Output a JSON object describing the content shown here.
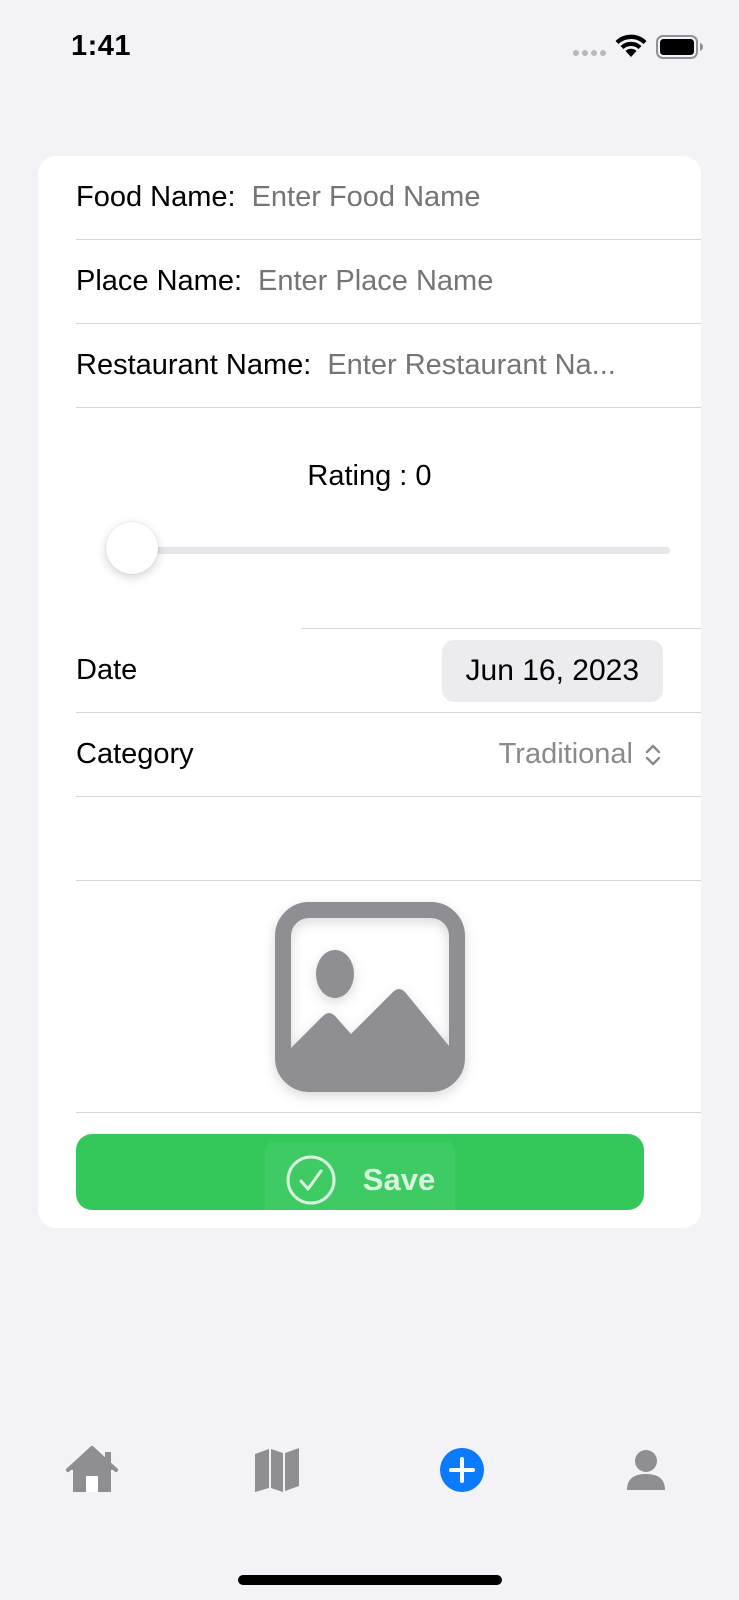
{
  "status_bar": {
    "time": "1:41"
  },
  "form": {
    "food_name": {
      "label": "Food Name:",
      "placeholder": "Enter Food Name"
    },
    "place_name": {
      "label": "Place Name:",
      "placeholder": "Enter Place Name"
    },
    "restaurant_name": {
      "label": "Restaurant Name:",
      "placeholder": "Enter Restaurant Na..."
    },
    "rating": {
      "label": "Rating : 0",
      "value": 0
    },
    "date": {
      "label": "Date",
      "value": "Jun 16, 2023"
    },
    "category": {
      "label": "Category",
      "value": "Traditional"
    },
    "photo": {
      "icon": "photo-placeholder-icon"
    },
    "save_button": {
      "label": "Save",
      "icon": "checkmark-circle-icon"
    }
  },
  "tab_bar": {
    "items": [
      {
        "icon": "home-icon",
        "active": false
      },
      {
        "icon": "map-icon",
        "active": false
      },
      {
        "icon": "add-circle-icon",
        "active": true
      },
      {
        "icon": "person-icon",
        "active": false
      }
    ]
  },
  "colors": {
    "background": "#F2F2F7",
    "card": "#FFFFFF",
    "accent_blue": "#0A7AFF",
    "save_green": "#34C85A",
    "inactive_gray": "#8E8E93",
    "placeholder_gray": "#C4C4C6"
  }
}
